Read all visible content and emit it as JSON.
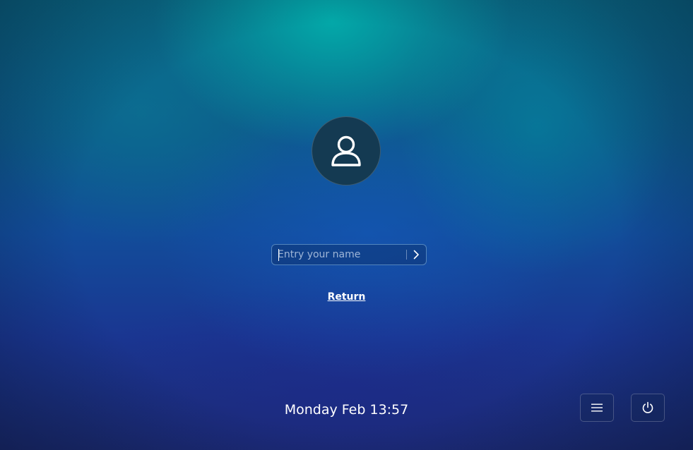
{
  "login": {
    "avatar_icon": "user-icon",
    "name_input": {
      "value": "",
      "placeholder": "Entry your name"
    },
    "submit_icon": "chevron-right-icon",
    "return_label": "Return"
  },
  "status": {
    "datetime": "Monday Feb 13:57"
  },
  "controls": {
    "menu_icon": "hamburger-menu-icon",
    "power_icon": "power-icon"
  },
  "colors": {
    "background_top": "#0a6b86",
    "background_bottom": "#1b2a70",
    "avatar_bg": "#143a52",
    "text": "#ffffff"
  }
}
